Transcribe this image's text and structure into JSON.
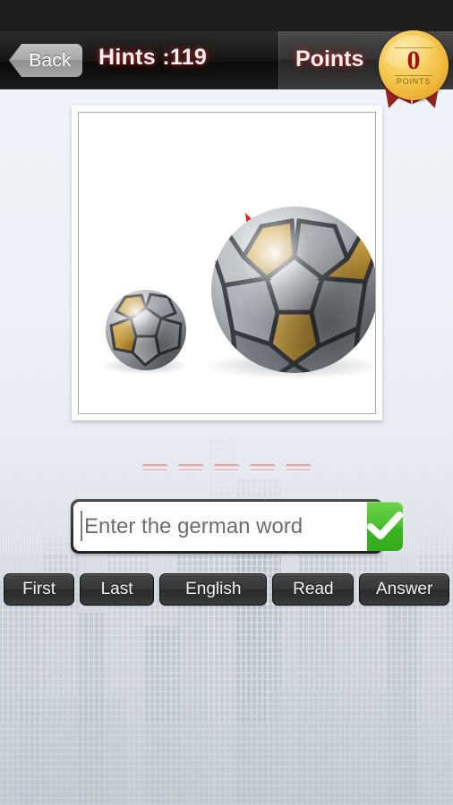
{
  "app": {
    "status_bar": "",
    "background_scene": "faded-city-skyline"
  },
  "navbar": {
    "back_label": "Back",
    "hints_label": "Hints :119",
    "points_label": "Points"
  },
  "badge": {
    "value": "0",
    "caption": "POINTS",
    "accent_color": "#a01212",
    "gold_color": "#f0bb3c"
  },
  "photo": {
    "alt": "two metallic soccer balls with a red arrow pointing at the small one",
    "arrow_color": "#d91f1f",
    "balls": [
      {
        "name": "small-ball",
        "label": "small"
      },
      {
        "name": "large-ball",
        "label": "large"
      }
    ]
  },
  "hint": {
    "dash_count": 5,
    "dashes": [
      "_",
      "_",
      "_",
      "_",
      "_"
    ],
    "dash_color": "#c98f8f"
  },
  "input": {
    "placeholder": "Enter the german word",
    "value": "",
    "submit_icon": "checkmark-icon",
    "submit_color": "#3cb524"
  },
  "toolbar": {
    "buttons": [
      {
        "name": "first-button",
        "label": "First"
      },
      {
        "name": "last-button",
        "label": "Last"
      },
      {
        "name": "english-button",
        "label": "English"
      },
      {
        "name": "read-button",
        "label": "Read"
      },
      {
        "name": "answer-button",
        "label": "Answer"
      }
    ]
  }
}
